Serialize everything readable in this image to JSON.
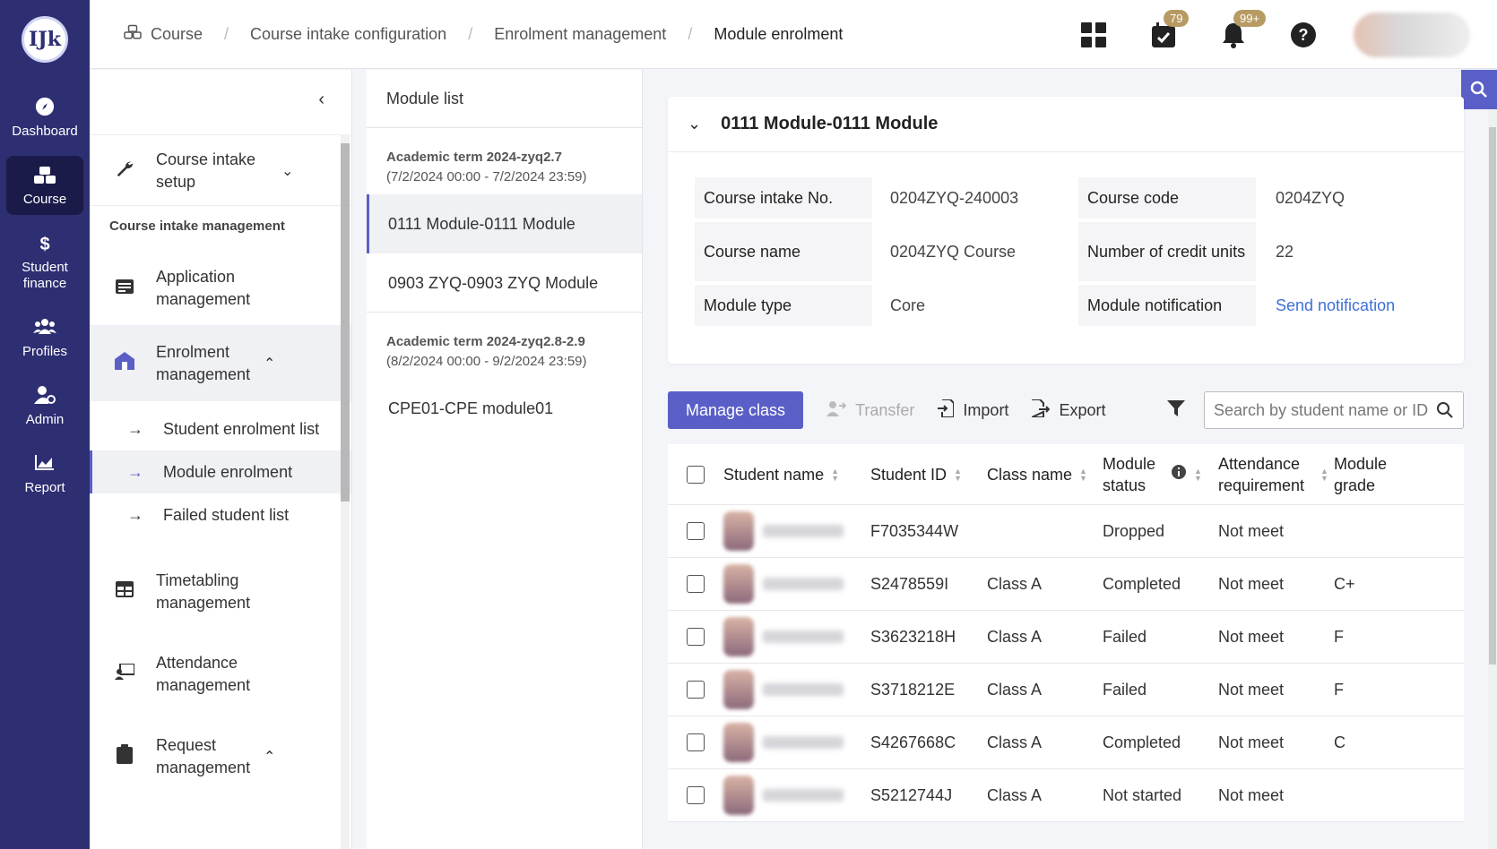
{
  "rail": {
    "logo": "IJk",
    "items": [
      {
        "label": "Dashboard",
        "icon": "compass-icon"
      },
      {
        "label": "Course",
        "icon": "course-icon",
        "active": true
      },
      {
        "label": "Student\nfinance",
        "icon": "dollar-icon"
      },
      {
        "label": "Profiles",
        "icon": "users-icon"
      },
      {
        "label": "Admin",
        "icon": "admin-icon"
      },
      {
        "label": "Report",
        "icon": "chart-icon"
      }
    ]
  },
  "breadcrumb": {
    "items": [
      "Course",
      "Course intake configuration",
      "Enrolment management",
      "Module enrolment"
    ]
  },
  "top": {
    "calendar_badge": "79",
    "bell_badge": "99+"
  },
  "sidebar": {
    "course_intake_setup": "Course intake setup",
    "section_label": "Course intake management",
    "application_management": "Application management",
    "enrolment_management": "Enrolment management",
    "sub_items": [
      "Student enrolment list",
      "Module enrolment",
      "Failed student list"
    ],
    "timetabling_management": "Timetabling management",
    "attendance_management": "Attendance management",
    "request_management": "Request management"
  },
  "module_list": {
    "title": "Module list",
    "terms": [
      {
        "name": "Academic term 2024-zyq2.7",
        "range": "(7/2/2024 00:00 - 7/2/2024 23:59)",
        "modules": [
          "0111 Module-0111 Module",
          "0903 ZYQ-0903 ZYQ Module"
        ]
      },
      {
        "name": "Academic term 2024-zyq2.8-2.9",
        "range": "(8/2/2024 00:00 - 9/2/2024 23:59)",
        "modules": [
          "CPE01-CPE module01"
        ]
      }
    ]
  },
  "module_card": {
    "title": "0111 Module-0111 Module",
    "labels": {
      "course_intake_no": "Course intake No.",
      "course_code": "Course code",
      "course_name": "Course name",
      "credit_units": "Number of credit units",
      "module_type": "Module type",
      "module_notification": "Module notification"
    },
    "values": {
      "course_intake_no": "0204ZYQ-240003",
      "course_code": "0204ZYQ",
      "course_name": "0204ZYQ Course",
      "credit_units": "22",
      "module_type": "Core",
      "module_notification": "Send notification"
    }
  },
  "toolbar": {
    "manage_class": "Manage class",
    "transfer": "Transfer",
    "import": "Import",
    "export": "Export",
    "search_placeholder": "Search by student name or ID"
  },
  "table": {
    "headers": {
      "student_name": "Student name",
      "student_id": "Student ID",
      "class_name": "Class name",
      "module_status": "Module status",
      "attendance": "Attendance requirement",
      "grade": "Module grade"
    },
    "rows": [
      {
        "id": "F7035344W",
        "class": "",
        "status": "Dropped",
        "attendance": "Not meet",
        "grade": ""
      },
      {
        "id": "S2478559I",
        "class": "Class A",
        "status": "Completed",
        "attendance": "Not meet",
        "grade": "C+"
      },
      {
        "id": "S3623218H",
        "class": "Class A",
        "status": "Failed",
        "attendance": "Not meet",
        "grade": "F"
      },
      {
        "id": "S3718212E",
        "class": "Class A",
        "status": "Failed",
        "attendance": "Not meet",
        "grade": "F"
      },
      {
        "id": "S4267668C",
        "class": "Class A",
        "status": "Completed",
        "attendance": "Not meet",
        "grade": "C"
      },
      {
        "id": "S5212744J",
        "class": "Class A",
        "status": "Not started",
        "attendance": "Not meet",
        "grade": ""
      }
    ]
  },
  "colors": {
    "rail_bg": "#2e2e72",
    "accent": "#5a5fc7",
    "link": "#3f6fd8",
    "badge": "#b89b63"
  }
}
